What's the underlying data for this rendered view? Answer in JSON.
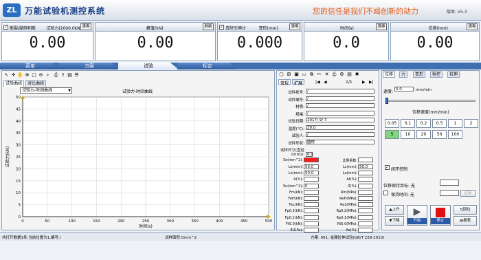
{
  "app": {
    "logo": "ZL",
    "title": "万能试验机测控系统",
    "slogan": "您的信任是我们不竭创新的动力",
    "version": "版本: V5.3"
  },
  "gauges": [
    {
      "checkbox": true,
      "label1": "断裂/破碎判断",
      "label2": "试验力(2000.0kN)",
      "button": "清零",
      "value": "0.00"
    },
    {
      "checkbox": false,
      "label1": "",
      "label2": "峰值(kN)",
      "button": "刷新",
      "value": "0.00"
    },
    {
      "checkbox": true,
      "label1": "去除引伸计",
      "label2": "变形(mm)",
      "button": "清零",
      "value": "0.000"
    },
    {
      "checkbox": false,
      "label1": "",
      "label2": "时间(s)",
      "button": "清零",
      "value": "0.0"
    },
    {
      "checkbox": false,
      "label1": "",
      "label2": "位移(mm)",
      "button": "清零",
      "value": "0.00"
    }
  ],
  "main_tabs": [
    "菜单",
    "方案",
    "试验",
    "标定"
  ],
  "left": {
    "subtabs": [
      "试验曲线",
      "对比曲线"
    ],
    "curve_select": "试验力-时间曲线",
    "chart_title": "试验力-时间曲线"
  },
  "chart_data": {
    "type": "line",
    "title": "试验力-时间曲线",
    "xlabel": "时间(s)",
    "ylabel": "试验力(kN)",
    "xlim": [
      0,
      500
    ],
    "ylim": [
      0,
      50
    ],
    "xticks": [
      "0",
      "50",
      "100",
      "150",
      "200",
      "250",
      "300",
      "350",
      "400",
      "450",
      "500"
    ],
    "yticks": [
      "0",
      "5",
      "10",
      "15",
      "20",
      "25",
      "30",
      "35",
      "40",
      "45",
      "50"
    ],
    "grid": true,
    "series": []
  },
  "form": {
    "tabs": [
      "常规",
      "扩展"
    ],
    "page": "1/1",
    "fields": [
      {
        "label": "试件批号:",
        "value": "/"
      },
      {
        "label": "试件编号:",
        "value": "/"
      },
      {
        "label": "材质:",
        "value": "/"
      },
      {
        "label": "规格:",
        "value": "/"
      },
      {
        "label": "试验日期:",
        "value": "2017/ 9/ 7"
      },
      {
        "label": "温度(℃):",
        "value": "20.0"
      },
      {
        "label": "试验人:",
        "value": "/"
      },
      {
        "label": "试件形状:",
        "value": "圆材"
      },
      {
        "label": "试样尺寸(直径(mm)):",
        "value": "0.0"
      }
    ],
    "so_label": "So(mm^2):",
    "ratio_label": "比例系数:",
    "left_results": [
      "Le(mm):",
      "Lo(mm):",
      "A(%):",
      "Su(mm^2):",
      "Fm(kN):",
      "FeH(kN):",
      "FeL(kN):",
      "Fp0.2(kN):",
      "Fp0.1(kN):",
      "Ft5.0(kN):",
      "E(GPa):"
    ],
    "left_values": [
      "50.0",
      "50.0",
      "",
      "0",
      "",
      "",
      "",
      "",
      "",
      "",
      ""
    ],
    "right_results": [
      "Lc(mm):",
      "Lu(mm):",
      "At(%):",
      "Z(%):",
      "Rm(MPa):",
      "ReH(MPa):",
      "ReL(MPa):",
      "Rp0.2(MPa):",
      "Rp0.1(MPa):",
      "Rt5.0(MPa):",
      "Ae(%):"
    ],
    "right_values": [
      "50.0",
      "",
      "",
      "",
      "",
      "",
      "",
      "",
      "",
      "",
      ""
    ]
  },
  "control": {
    "tabs": [
      "位移",
      "力",
      "变形",
      "程控",
      "拉伸"
    ],
    "speed_label": "速度:",
    "speed_value": "5.0",
    "speed_unit": "mm/min",
    "speed_group": "位移速度(mm/min)",
    "speed_buttons": [
      "0.05",
      "0.1",
      "0.2",
      "0.5",
      "1",
      "2",
      "5",
      "10",
      "20",
      "50",
      "100"
    ],
    "speed_selected": "5",
    "closed_loop": "闭环控制",
    "hold_target_label": "位移保持目标: 无",
    "hold_time_label": "保持时间: 无",
    "apply": "应用",
    "up": "上升",
    "down": "下降",
    "start": "开始",
    "stop": "停止",
    "return": "回位",
    "report": "报表"
  },
  "status": {
    "left": "共打开数据1条,当前位置为1,编号:/",
    "mid": "试样面积:0mm^2",
    "right": "方案: 001, 金属拉伸试验(GB/T 228-2010)"
  },
  "colors": {
    "accent": "#3f6fb0",
    "slogan": "#e05a1a",
    "selected_speed": "#7fd67f",
    "so_red": "#ff1a1a"
  }
}
